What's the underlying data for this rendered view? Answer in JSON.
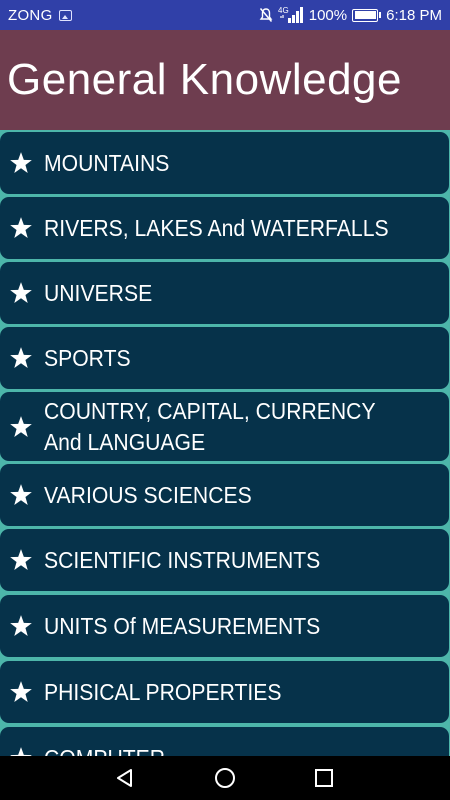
{
  "status_bar": {
    "carrier": "ZONG",
    "network": "4G",
    "battery_percent": "100%",
    "battery_level": 1.0,
    "time": "6:18 PM",
    "icons": [
      "image-icon",
      "mute-icon",
      "signal-icon",
      "battery-icon"
    ]
  },
  "header": {
    "title": "General Knowledge",
    "background": "#6e3d4f"
  },
  "categories": [
    {
      "label": "MOUNTAINS",
      "icon": "star-icon"
    },
    {
      "label": "RIVERS, LAKES And WATERFALLS",
      "icon": "star-icon"
    },
    {
      "label": "UNIVERSE",
      "icon": "star-icon"
    },
    {
      "label": "SPORTS",
      "icon": "star-icon"
    },
    {
      "label": "COUNTRY, CAPITAL, CURRENCY And LANGUAGE",
      "icon": "star-icon"
    },
    {
      "label": "VARIOUS SCIENCES",
      "icon": "star-icon"
    },
    {
      "label": "SCIENTIFIC INSTRUMENTS",
      "icon": "star-icon"
    },
    {
      "label": "UNITS Of MEASUREMENTS",
      "icon": "star-icon"
    },
    {
      "label": "PHISICAL PROPERTIES",
      "icon": "star-icon"
    },
    {
      "label": "COMPUTER",
      "icon": "star-icon"
    }
  ],
  "colors": {
    "list_background": "#4db6aa",
    "item_background": "#06324a",
    "status_bar": "#3040a8",
    "nav_bar": "#000000"
  },
  "nav_bar": {
    "icons": [
      "back-icon",
      "home-icon",
      "recents-icon"
    ]
  }
}
